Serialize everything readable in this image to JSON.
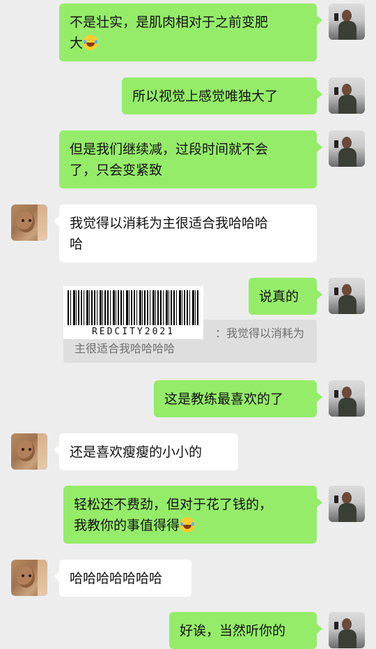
{
  "messages": [
    {
      "side": "out",
      "lines": [
        "不是壮实，是肌肉相对于之前变肥",
        "大"
      ],
      "emoji_end": true
    },
    {
      "side": "out",
      "lines": [
        "所以视觉上感觉唯独大了"
      ]
    },
    {
      "side": "out",
      "lines": [
        "但是我们继续减，过段时间就不会",
        "了，只会变紧致"
      ]
    },
    {
      "side": "in",
      "lines": [
        "我觉得以消耗为主很适合我哈哈哈",
        "哈"
      ]
    },
    {
      "side": "out",
      "lines": [
        "说真的"
      ]
    },
    {
      "side": "out",
      "lines": [
        "这是教练最喜欢的了"
      ]
    },
    {
      "side": "in",
      "lines": [
        "还是喜欢瘦瘦的小小的"
      ]
    },
    {
      "side": "out",
      "lines": [
        "轻松还不费劲，但对于花了钱的，",
        "我教你的事值得得"
      ],
      "emoji_end": true
    },
    {
      "side": "in",
      "lines": [
        "哈哈哈哈哈哈哈"
      ]
    },
    {
      "side": "out",
      "lines": [
        "好诶，当然听你的"
      ]
    }
  ],
  "quote": {
    "line1": "：我觉得以消耗为",
    "line2": "主很适合我哈哈哈哈"
  },
  "watermark": {
    "code": "REDCITY2021"
  },
  "emoji": "grin-sweat-emoji"
}
